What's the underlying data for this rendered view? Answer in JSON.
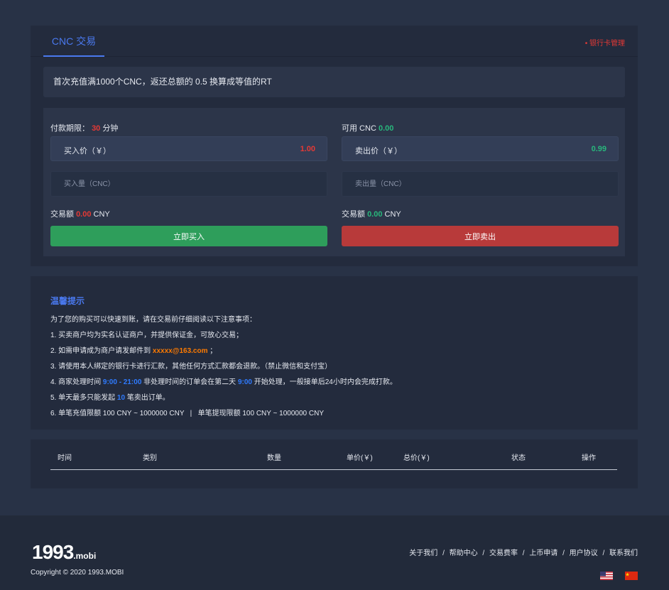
{
  "header": {
    "tab_label": "CNC 交易",
    "bank_link": "• 银行卡管理"
  },
  "notice": "首次充值满1000个CNC，返还总额的 0.5 换算成等值的RT",
  "buy": {
    "deadline_prefix": "付款期限：",
    "deadline_value": "30",
    "deadline_unit": "分钟",
    "price_label": "买入价（￥）",
    "price_value": "1.00",
    "qty_placeholder": "买入量（CNC）",
    "amount_prefix": "交易额",
    "amount_value": "0.00",
    "amount_unit": "CNY",
    "button_label": "立即买入"
  },
  "sell": {
    "available_prefix": "可用 CNC",
    "available_value": "0.00",
    "price_label": "卖出价（￥）",
    "price_value": "0.99",
    "qty_placeholder": "卖出量（CNC）",
    "amount_prefix": "交易额",
    "amount_value": "0.00",
    "amount_unit": "CNY",
    "button_label": "立即卖出"
  },
  "tips": {
    "title": "温馨提示",
    "intro": "为了您的购买可以快速到账，请在交易前仔细阅读以下注意事项：",
    "line1": "1. 买卖商户均为实名认证商户，并提供保证金，可放心交易；",
    "line2_prefix": "2. 如需申请成为商户请发邮件到",
    "line2_email": "xxxxx@163.com",
    "line2_suffix": "；",
    "line3": "3. 请使用本人绑定的银行卡进行汇款，其他任何方式汇款都会退款。（禁止微信和支付宝）",
    "line4_prefix": "4. 商家处理时间",
    "line4_time": "9:00 - 21:00",
    "line4_mid": "非处理时间的订单会在第二天",
    "line4_time2": "9:00",
    "line4_suffix": "开始处理，一般接单后24小时内会完成打款。",
    "line5_prefix": "5. 单天最多只能发起",
    "line5_count": "10",
    "line5_suffix": "笔卖出订单。",
    "line6": "6. 单笔充值限额 100 CNY ~ 1000000 CNY   |   单笔提现限额 100 CNY ~ 1000000 CNY"
  },
  "table": {
    "headers": [
      "时间",
      "类别",
      "数量",
      "单价(￥)",
      "总价(￥)",
      "状态",
      "操作"
    ]
  },
  "footer": {
    "logo_main": "1993",
    "logo_sub": ".mobi",
    "copyright": "Copyright © 2020 1993.MOBI",
    "links": [
      "关于我们",
      "帮助中心",
      "交易费率",
      "上币申请",
      "用户协议",
      "联系我们"
    ]
  },
  "colors": {
    "accent_blue": "#4a79ef",
    "buy_green": "#2e9e5b",
    "sell_red": "#b83a3a",
    "price_red": "#e53935",
    "price_green": "#28b77c"
  }
}
